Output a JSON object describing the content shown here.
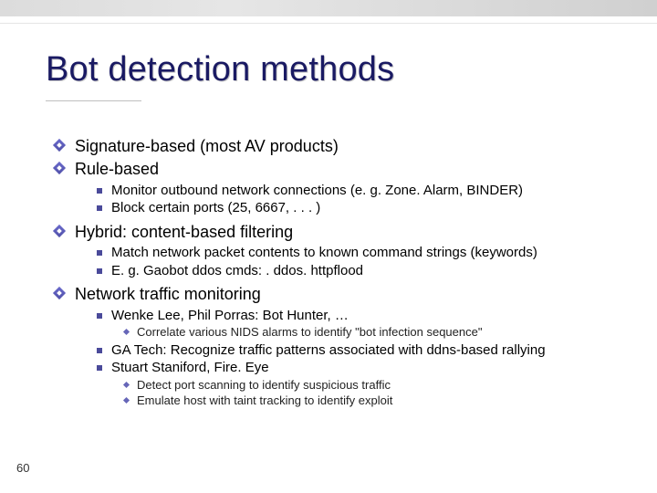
{
  "slide": {
    "title": "Bot detection methods",
    "page_number": "60",
    "bullets": [
      {
        "text": "Signature-based (most AV products)"
      },
      {
        "text": "Rule-based",
        "sub": [
          {
            "text": "Monitor outbound network connections (e. g. Zone. Alarm, BINDER)"
          },
          {
            "text": "Block certain ports (25, 6667, . . . )"
          }
        ]
      },
      {
        "text": "Hybrid: content-based filtering",
        "sub": [
          {
            "text": "Match network packet contents to known command strings (keywords)"
          },
          {
            "text": "E. g. Gaobot ddos cmds: . ddos. httpflood"
          }
        ]
      },
      {
        "text": "Network traffic monitoring",
        "sub": [
          {
            "text": "Wenke Lee, Phil Porras:  Bot Hunter, …",
            "sub": [
              {
                "text": "Correlate various NIDS alarms to identify \"bot infection sequence\""
              }
            ]
          },
          {
            "text": "GA Tech: Recognize traffic patterns associated with ddns-based rallying"
          },
          {
            "text": "Stuart Staniford, Fire. Eye",
            "sub": [
              {
                "text": "Detect port scanning to identify suspicious traffic"
              },
              {
                "text": "Emulate host with taint tracking to identify exploit"
              }
            ]
          }
        ]
      }
    ]
  }
}
